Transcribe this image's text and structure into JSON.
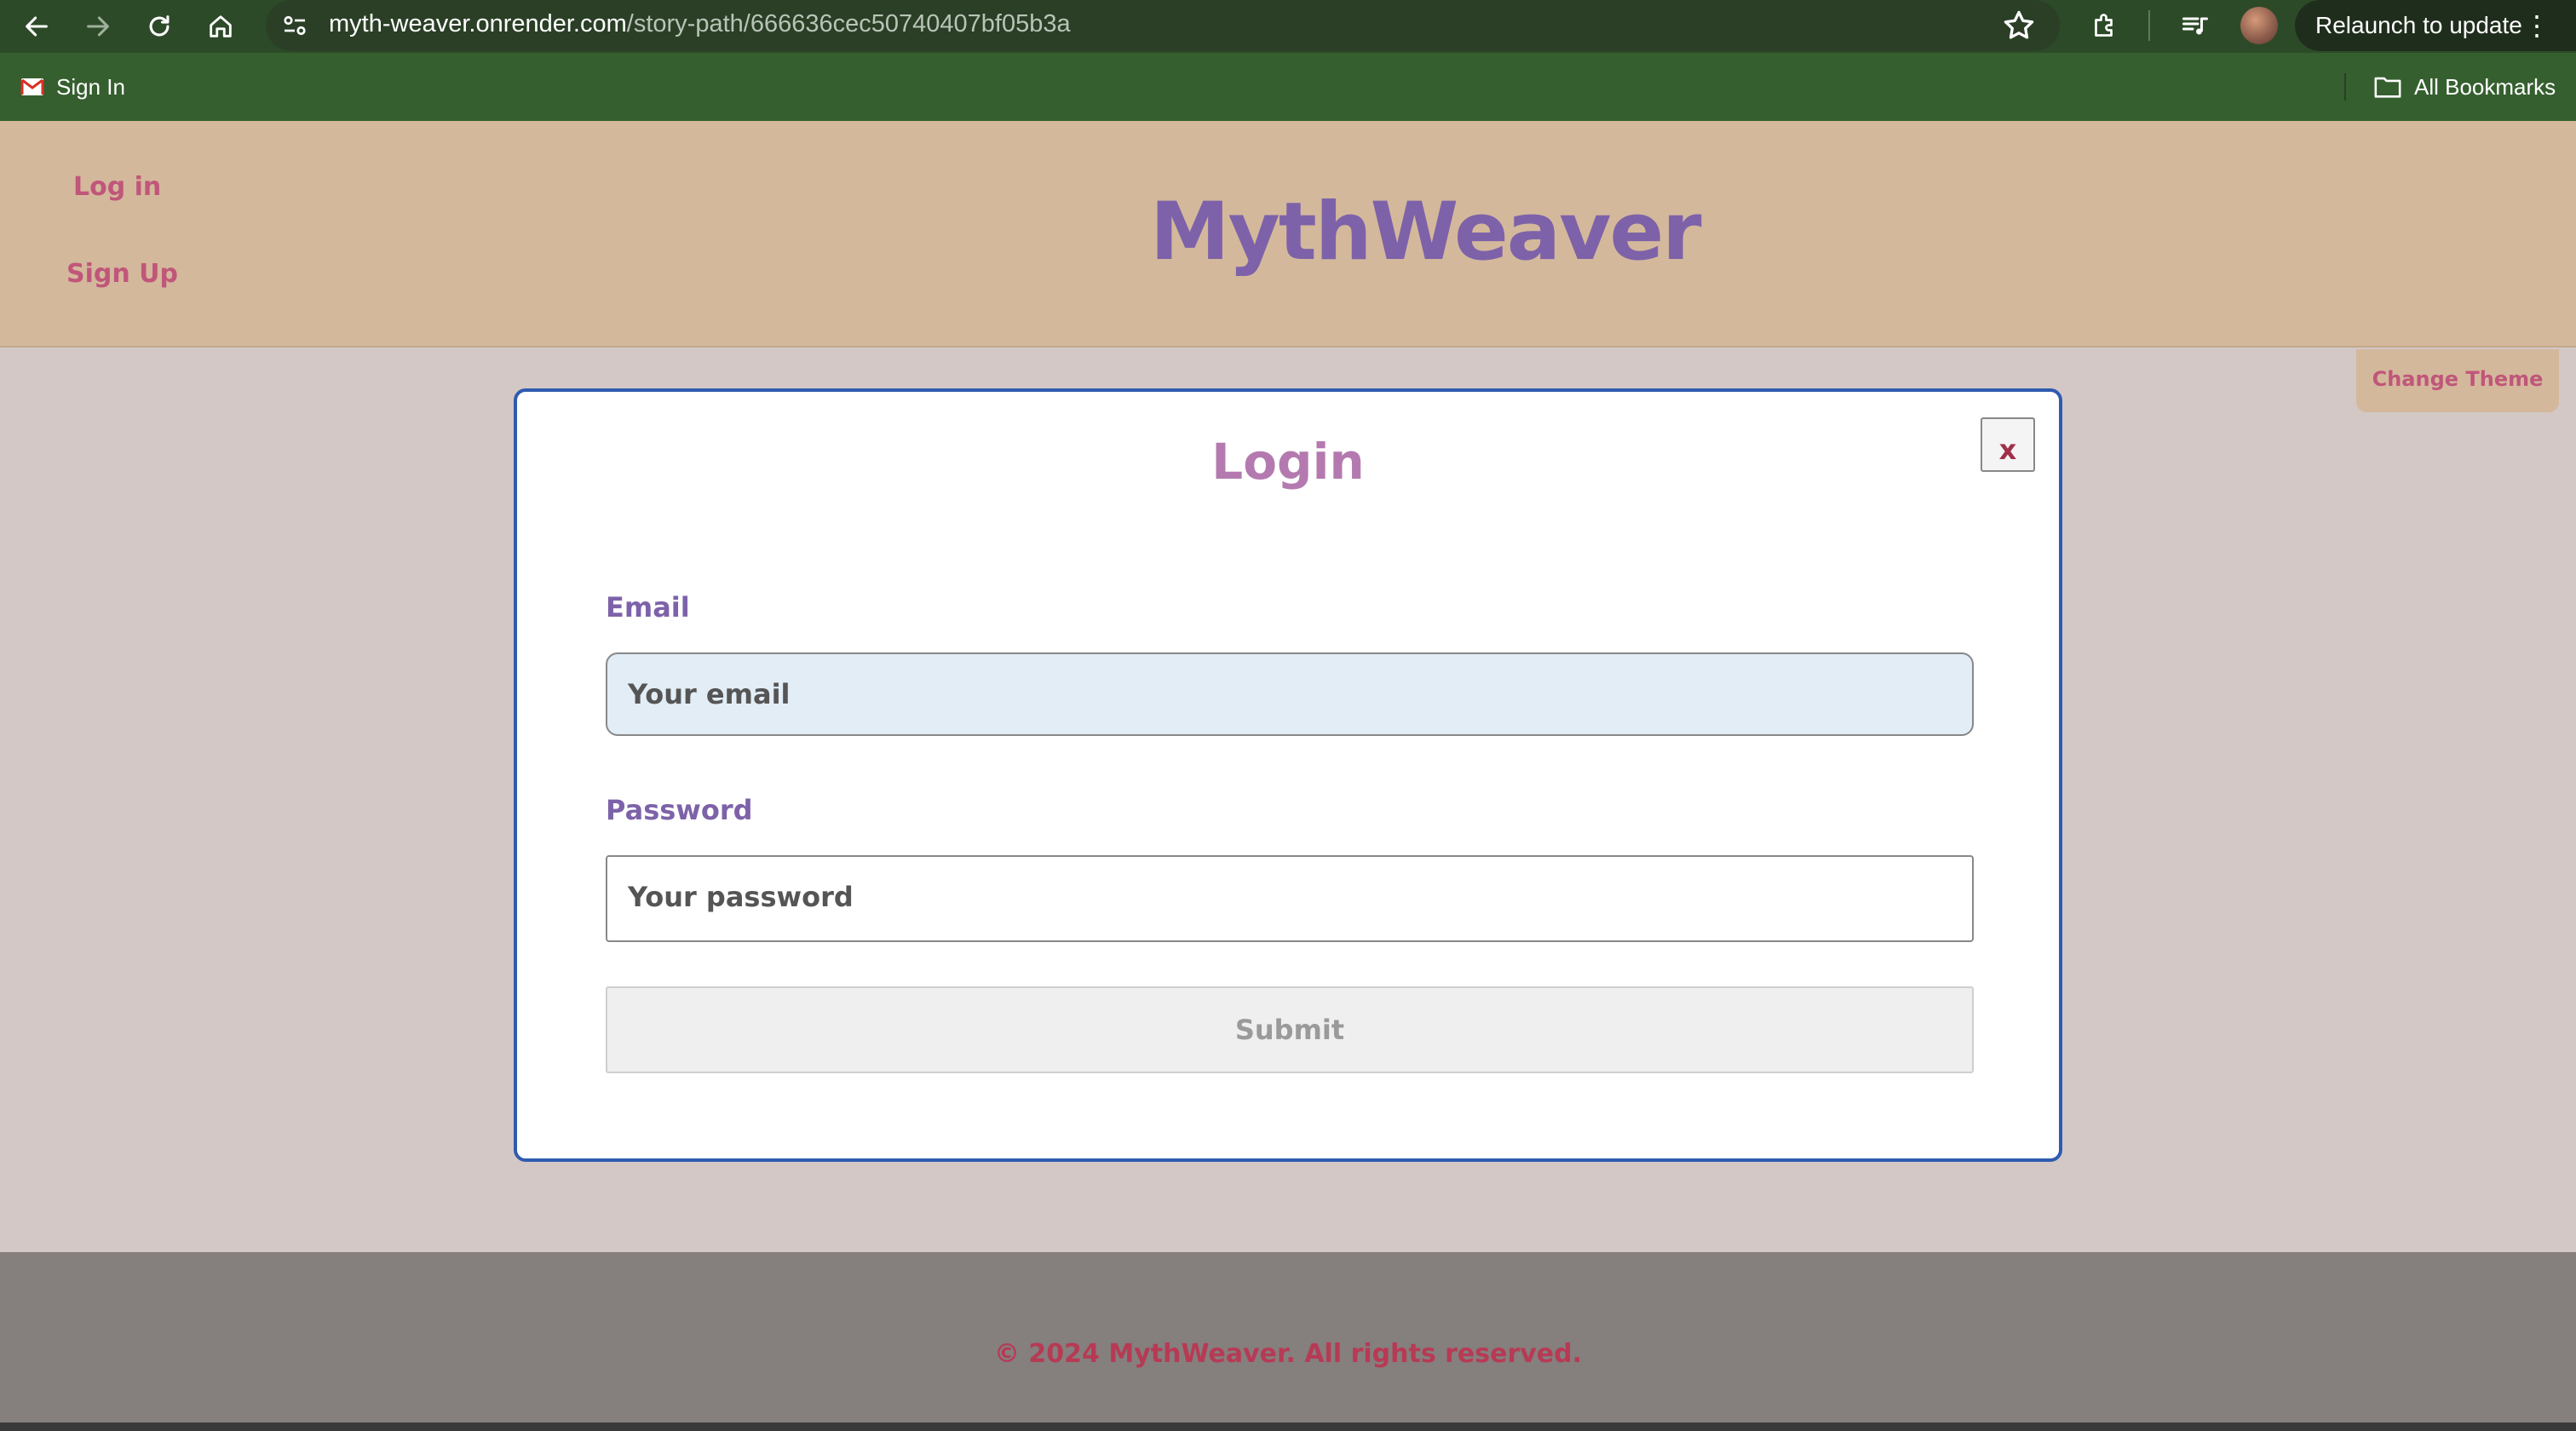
{
  "browser": {
    "url_host": "myth-weaver.onrender.com",
    "url_path": "/story-path/666636cec50740407bf05b3a",
    "relaunch_label": "Relaunch to update",
    "bookmarks": {
      "signin_label": "Sign In",
      "all_bookmarks_label": "All Bookmarks"
    }
  },
  "header": {
    "login_link": "Log in",
    "signup_link": "Sign Up",
    "brand": "MythWeaver"
  },
  "theme_button": "Change Theme",
  "modal": {
    "title": "Login",
    "close_label": "x",
    "email_label": "Email",
    "email_placeholder": "Your email",
    "password_label": "Password",
    "password_placeholder": "Your password",
    "submit_label": "Submit"
  },
  "footer": {
    "text": "© 2024 MythWeaver. All rights reserved."
  },
  "colors": {
    "chrome_bg": "#2d4a28",
    "header_bg": "#d4b89c",
    "brand": "#7d62a9",
    "link": "#c0567a",
    "modal_border": "#2f5bb0",
    "footer_bg": "#857f7d"
  }
}
